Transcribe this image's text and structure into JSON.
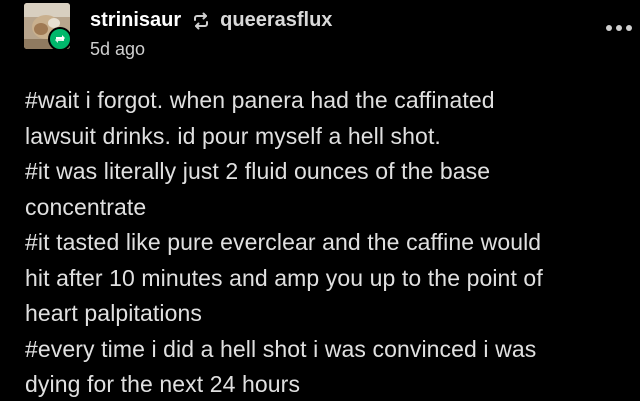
{
  "post": {
    "reblogger": "strinisaur",
    "source": "queerasflux",
    "time": "5d ago",
    "avatar_icon": "user-avatar",
    "reblog_icon": "reblog-icon",
    "menu_icon": "more-options-icon",
    "badge_color": "#00b86b"
  },
  "tags": [
    [
      "#wait i forgot. when panera had the caffinated",
      "lawsuit drinks. id pour myself a hell shot."
    ],
    [
      "#it was literally just 2 fluid ounces of the base",
      "concentrate"
    ],
    [
      "#it tasted like pure everclear and the caffine would",
      "hit after 10 minutes and amp you up to the point of",
      "heart palpitations"
    ],
    [
      "#every time i did a hell shot i was convinced i was",
      "dying for the next 24 hours"
    ]
  ]
}
